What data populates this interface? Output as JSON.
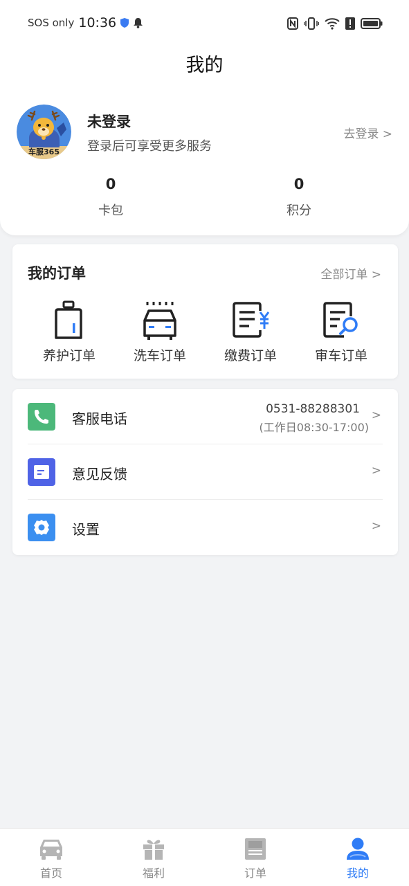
{
  "status_bar": {
    "carrier": "SOS only",
    "time": "10:36"
  },
  "page_title": "我的",
  "profile": {
    "avatar_text": "车服365",
    "name": "未登录",
    "subtitle": "登录后可享受更多服务",
    "login_link": "去登录 >",
    "stats": [
      {
        "value": "0",
        "label": "卡包"
      },
      {
        "value": "0",
        "label": "积分"
      }
    ]
  },
  "orders": {
    "title": "我的订单",
    "all_link": "全部订单 >",
    "items": [
      {
        "label": "养护订单",
        "icon": "maintenance-icon"
      },
      {
        "label": "洗车订单",
        "icon": "car-wash-icon"
      },
      {
        "label": "缴费订单",
        "icon": "payment-icon"
      },
      {
        "label": "审车订单",
        "icon": "inspection-icon"
      }
    ]
  },
  "services": [
    {
      "label": "客服电话",
      "icon": "phone-icon",
      "phone": "0531-88288301",
      "hours": "(工作日08:30-17:00)",
      "arrow": ">",
      "color": "#4cb87a"
    },
    {
      "label": "意见反馈",
      "icon": "feedback-icon",
      "arrow": ">",
      "color": "#4f63e6"
    },
    {
      "label": "设置",
      "icon": "settings-icon",
      "arrow": ">",
      "color": "#3b8ff0"
    }
  ],
  "bottom_nav": [
    {
      "label": "首页",
      "icon": "car-icon",
      "active": false
    },
    {
      "label": "福利",
      "icon": "gift-icon",
      "active": false
    },
    {
      "label": "订单",
      "icon": "order-icon",
      "active": false
    },
    {
      "label": "我的",
      "icon": "user-icon",
      "active": true
    }
  ],
  "colors": {
    "accent": "#2f7cf6",
    "background": "#f2f3f5",
    "inactive_nav": "#b5b5b5"
  }
}
